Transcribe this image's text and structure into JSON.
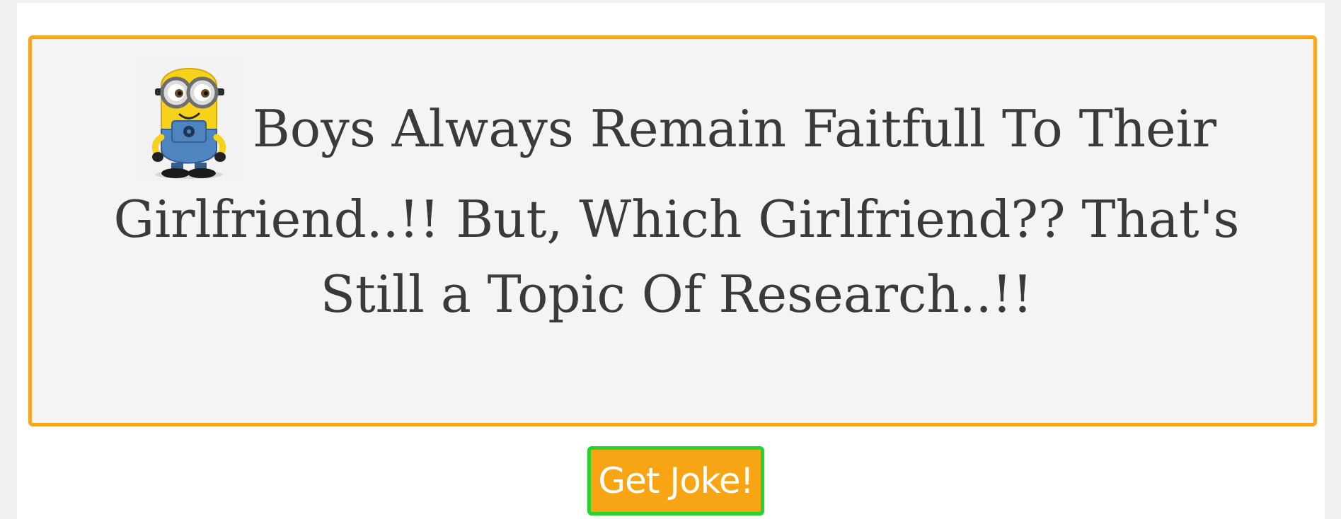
{
  "joke": {
    "image_icon": "minion-icon",
    "text": "Boys Always Remain Faitfull To Their Girlfriend..!! But, Which Girlfriend?? That's Still a Topic Of Research..!!"
  },
  "button": {
    "label": "Get Joke!"
  },
  "colors": {
    "box_border": "#f6a623",
    "box_background": "#f4f4f4",
    "button_background": "#f7a514",
    "button_border": "#26d430",
    "text": "#3a3a3a"
  }
}
